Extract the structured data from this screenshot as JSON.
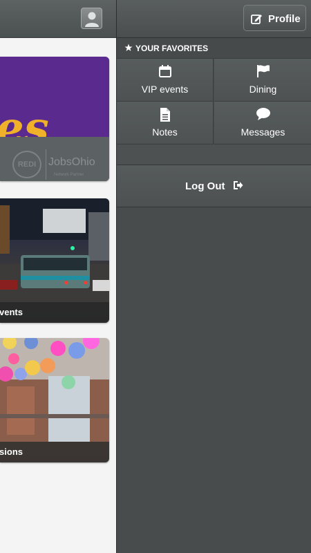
{
  "menu": {
    "profile_label": "Profile",
    "favorites_title": "YOUR FAVORITES",
    "tiles": [
      {
        "label": "VIP events",
        "icon": "calendar-icon"
      },
      {
        "label": "Dining",
        "icon": "flag-icon"
      },
      {
        "label": "Notes",
        "icon": "document-icon"
      },
      {
        "label": "Messages",
        "icon": "speech-bubble-icon"
      }
    ],
    "logout_label": "Log Out"
  },
  "app": {
    "cards": [
      {
        "label": "",
        "logo_text": "JobsOhio",
        "logo_sub": "Network Partner",
        "circle_text": "REDI",
        "script_text": "es"
      },
      {
        "label": "vents"
      },
      {
        "label": "rsions"
      }
    ]
  },
  "colors": {
    "panel_bg": "#484c4c",
    "content_bg": "#f4f4f4",
    "purple_banner": "#5b2a8e",
    "gold_script": "#f0b12a"
  }
}
